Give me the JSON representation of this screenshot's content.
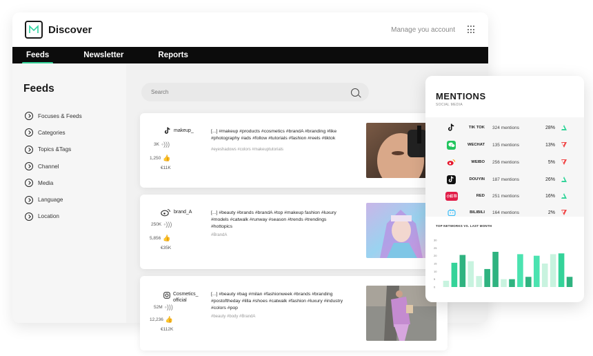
{
  "app": {
    "title": "Discover",
    "manage_label": "Manage you account"
  },
  "nav": {
    "tabs": [
      {
        "label": "Feeds"
      },
      {
        "label": "Newsletter"
      },
      {
        "label": "Reports"
      }
    ]
  },
  "sidebar": {
    "title": "Feeds",
    "items": [
      {
        "label": "Focuses & Feeds"
      },
      {
        "label": "Categories"
      },
      {
        "label": "Topics &Tags"
      },
      {
        "label": "Channel"
      },
      {
        "label": "Media"
      },
      {
        "label": "Language"
      },
      {
        "label": "Location"
      }
    ]
  },
  "search": {
    "placeholder": "Search"
  },
  "feeds": [
    {
      "account": "makeup_",
      "network_icon": "tiktok-icon",
      "reach": "3K",
      "likes": "1,250",
      "value": "€11K",
      "caption": "[...] #makeup #products #cosmetics #brandA #branding #like #photography #ads #follow #tutorials #fashion #reels #tiktok",
      "tags": "#eyeshadows #colors #makeuptutorials"
    },
    {
      "account": "brand_A",
      "network_icon": "weibo-icon",
      "reach": "250K",
      "likes": "5,856",
      "value": "€35K",
      "caption": "[...] #beauty #brands #brandA #top #makeup fashion #luxury #models #catwalk #runway #season #trends #trendings #hottopics",
      "tags": "#BrandA"
    },
    {
      "account": "Cosmetics_ official",
      "network_icon": "instagram-icon",
      "reach": "52M",
      "likes": "12,236",
      "value": "€112K",
      "caption": "[...] #beauty #bag #milan #fashionweek #brands #branding #postoftheday #lilla #shoes #catwalk #fashion #luxury #industry #colors #pop",
      "tags": "#beauty #body #BrandA"
    }
  ],
  "mentions": {
    "title": "MENTIONS",
    "subtitle": "SOCIAL MEDIA",
    "rows": [
      {
        "network": "TIK TOK",
        "count": "324 mentions",
        "pct": "28%",
        "trend": "up",
        "icon": "tiktok-icon",
        "color": "#111111"
      },
      {
        "network": "WECHAT",
        "count": "135 mentions",
        "pct": "13%",
        "trend": "down",
        "icon": "wechat-icon",
        "color": "#22c55e"
      },
      {
        "network": "WEIBO",
        "count": "256 mentions",
        "pct": "5%",
        "trend": "down",
        "icon": "weibo-icon",
        "color": "#e6162d"
      },
      {
        "network": "DOUYIN",
        "count": "187 mentions",
        "pct": "26%",
        "trend": "up",
        "icon": "douyin-icon",
        "color": "#111111"
      },
      {
        "network": "RED",
        "count": "251 mentions",
        "pct": "16%",
        "trend": "up",
        "icon": "red-icon",
        "color": "#e11d48"
      },
      {
        "network": "BILIBILI",
        "count": "164 mentions",
        "pct": "2%",
        "trend": "down",
        "icon": "bilibili-icon",
        "color": "#38bdf8"
      }
    ],
    "chart_title": "TOP NETWORKS VS. LAST MONTH"
  },
  "chart_data": {
    "type": "bar",
    "title": "TOP NETWORKS VS. LAST MONTH",
    "ytick_labels": [
      "30",
      "25",
      "20",
      "15",
      "10",
      "5",
      "0"
    ],
    "ylim": [
      0,
      30
    ],
    "bars": [
      {
        "value": 4,
        "color": "#c8f3df"
      },
      {
        "value": 15.5,
        "color": "#34d399"
      },
      {
        "value": 20.5,
        "color": "#2fb380"
      },
      {
        "value": 16.5,
        "color": "#c8f3df"
      },
      {
        "value": 7,
        "color": "#c8f3df"
      },
      {
        "value": 11.5,
        "color": "#2fb380"
      },
      {
        "value": 22.5,
        "color": "#2fb380"
      },
      {
        "value": 5,
        "color": "#c8f3df"
      },
      {
        "value": 5,
        "color": "#2fb380"
      },
      {
        "value": 21,
        "color": "#4be3b0"
      },
      {
        "value": 6.5,
        "color": "#2fb380"
      },
      {
        "value": 20,
        "color": "#4be3b0"
      },
      {
        "value": 15,
        "color": "#c8f3df"
      },
      {
        "value": 21,
        "color": "#c8f3df"
      },
      {
        "value": 21.5,
        "color": "#34d399"
      },
      {
        "value": 6.5,
        "color": "#2fb380"
      }
    ]
  }
}
